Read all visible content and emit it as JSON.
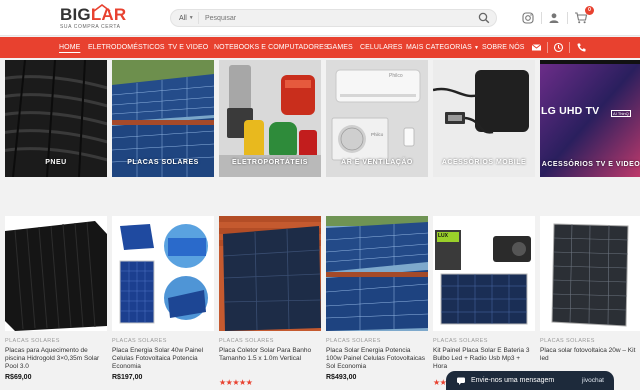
{
  "header": {
    "logo_main_a": "BIG",
    "logo_main_b": "LAR",
    "logo_sub": "SUA COMPRA CERTA",
    "search_category": "All",
    "search_placeholder": "Pesquisar",
    "cart_count": "0"
  },
  "nav": {
    "items": [
      {
        "label": "HOME"
      },
      {
        "label": "ELETRODOMÉSTICOS"
      },
      {
        "label": "TV E VIDEO"
      },
      {
        "label": "NOTEBOOKS E COMPUTADORES"
      },
      {
        "label": "GAMES"
      },
      {
        "label": "CELULARES"
      },
      {
        "label": "MAIS CATEGORIAS"
      },
      {
        "label": "SOBRE NÓS"
      }
    ]
  },
  "categories": [
    {
      "label": "PNEU"
    },
    {
      "label": "PLACAS SOLARES"
    },
    {
      "label": "ELETROPORTÁTEIS"
    },
    {
      "label": "AR E VENTILAÇÃO"
    },
    {
      "label": "ACESSÓRIOS MOBILE"
    },
    {
      "label": "ACESSÓRIOS TV E VIDEO"
    }
  ],
  "category_image_text": {
    "tv_brand": "LG UHD TV",
    "tv_badge": "AI ThinQ",
    "ac_brand": "Philco"
  },
  "products": [
    {
      "category": "PLACAS SOLARES",
      "name": "Placas para Aquecimento de piscina Hidrogold 3×0,35m Solar Pool 3.0",
      "price": "R$69,00"
    },
    {
      "category": "PLACAS SOLARES",
      "name": "Placa Energia Solar 40w Painel Celulas Fotovoltaica Potencia Economia",
      "price": "R$197,00"
    },
    {
      "category": "PLACAS SOLARES",
      "name": "Placa Coletor Solar Para Banho Tamanho 1.5 x 1.0m Vertical",
      "price": ""
    },
    {
      "category": "PLACAS SOLARES",
      "name": "Placa Solar Energia Potencia 100w Painel Celulas Fotovoltaicas Sol Economia",
      "price": "R$493,00"
    },
    {
      "category": "PLACAS SOLARES",
      "name": "Kit Painel Placa Solar E Bateria 3 Bulbo Led + Radio Usb Mp3 + Hora",
      "price": ""
    },
    {
      "category": "PLACAS SOLARES",
      "name": "Placa solar fotovoltaica 20w – Kit led",
      "price": ""
    }
  ],
  "product_image_text": {
    "kit_box_brand": "LUX"
  },
  "ratings": {
    "placa_coletor": 5,
    "kit_painel": 2
  },
  "chat": {
    "label": "Envie-nos uma mensagem",
    "brand": "jivochat"
  },
  "colors": {
    "accent": "#e8412f",
    "nav_bg": "#e8412f",
    "chat_bg": "#1d2a3b"
  }
}
